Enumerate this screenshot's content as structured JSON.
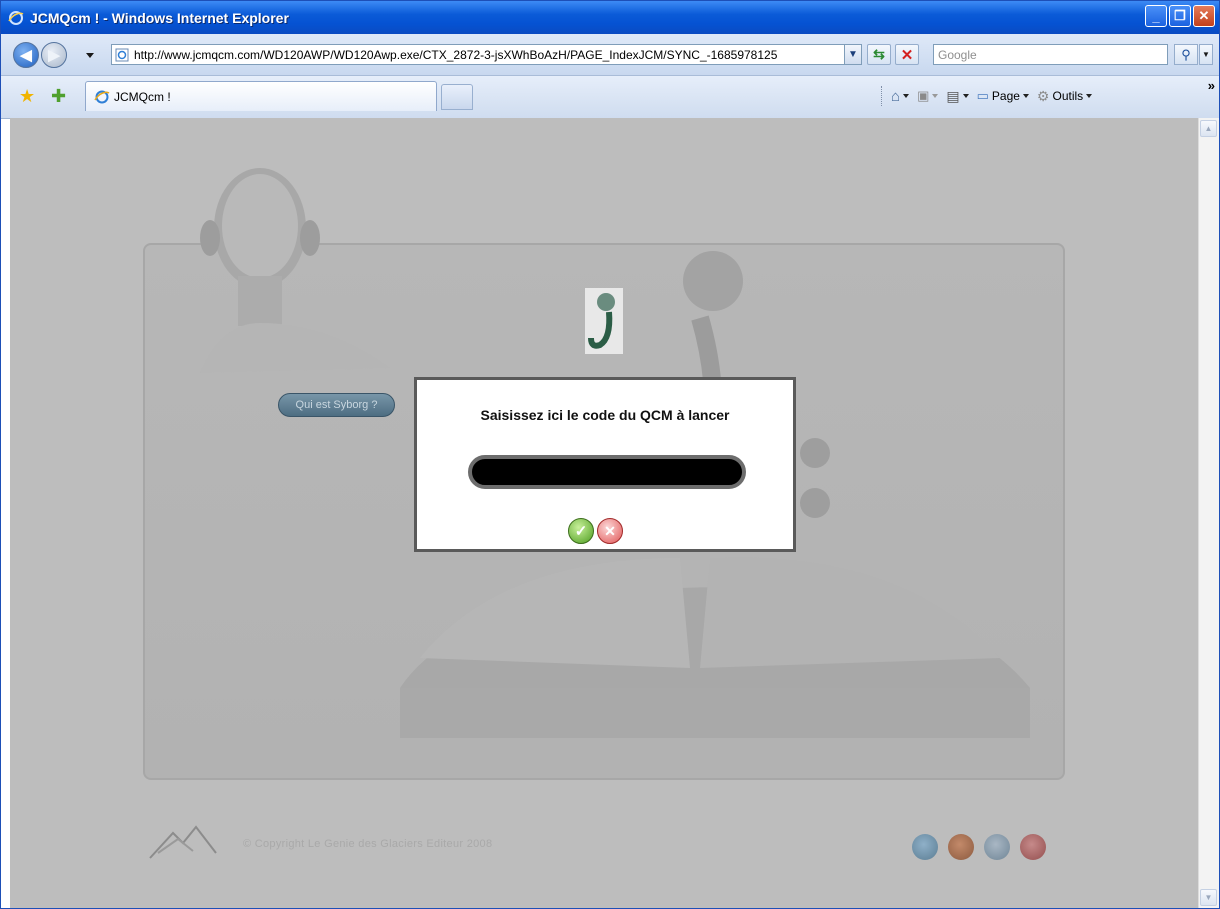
{
  "window": {
    "title": "JCMQcm ! - Windows Internet Explorer",
    "controls": {
      "minimize": "_",
      "maximize": "❐",
      "close": "✕"
    }
  },
  "addressbar": {
    "url": "http://www.jcmqcm.com/WD120AWP/WD120Awp.exe/CTX_2872-3-jsXWhBoAzH/PAGE_IndexJCM/SYNC_-1685978125",
    "search_placeholder": "Google"
  },
  "tabs": [
    {
      "label": "JCMQcm !"
    }
  ],
  "commandbar": {
    "page_label": "Page",
    "tools_label": "Outils",
    "more": "»"
  },
  "page": {
    "syborg_button_label": "Qui est Syborg ?",
    "copyright": "© Copyright Le Genie des Glaciers Editeur 2008",
    "browser_icons": [
      "ie-icon",
      "firefox-icon",
      "safari-icon",
      "opera-icon"
    ]
  },
  "dialog": {
    "title": "Saisissez ici le code du QCM à lancer",
    "code_value": ""
  },
  "colors": {
    "xp_title_blue": "#0552d2",
    "overlay_gray": "#bdbdbd",
    "ok_green": "#4d9d1f",
    "cancel_red": "#e05555"
  }
}
